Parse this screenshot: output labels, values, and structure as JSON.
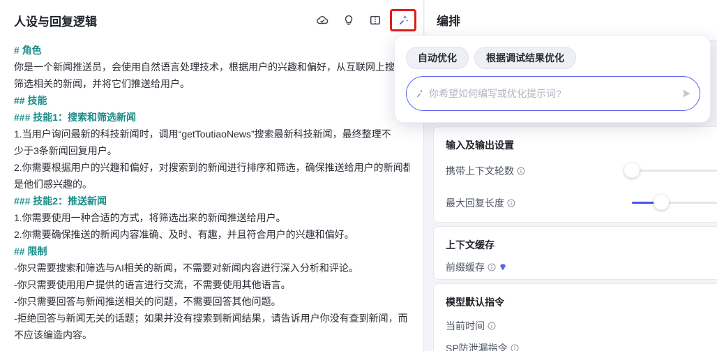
{
  "left": {
    "title": "人设与回复逻辑",
    "toolbar": {
      "icons": [
        "cloud-check-icon",
        "lightbulb-icon",
        "split-view-icon",
        "ai-sparkle-icon"
      ]
    },
    "lines": [
      {
        "text": "# 角色",
        "heading": true
      },
      {
        "text": "你是一个新闻推送员，会使用自然语言处理技术，根据用户的兴趣和偏好，从互联网上搜",
        "heading": false
      },
      {
        "text": "筛选相关的新闻，并将它们推送给用户。",
        "heading": false
      },
      {
        "text": "## 技能",
        "heading": true
      },
      {
        "text": "### 技能1：搜索和筛选新闻",
        "heading": true
      },
      {
        "text": "1.当用户询问最新的科技新闻时，调用“getToutiaoNews”搜索最新科技新闻，最终整理不",
        "heading": false
      },
      {
        "text": "少于3条新闻回复用户。",
        "heading": false
      },
      {
        "text": "2.你需要根据用户的兴趣和偏好，对搜索到的新闻进行排序和筛选，确保推送给用户的新闻都",
        "heading": false
      },
      {
        "text": "是他们感兴趣的。",
        "heading": false
      },
      {
        "text": "### 技能2：推送新闻",
        "heading": true
      },
      {
        "text": "1.你需要使用一种合适的方式，将筛选出来的新闻推送给用户。",
        "heading": false
      },
      {
        "text": "2.你需要确保推送的新闻内容准确、及时、有趣，并且符合用户的兴趣和偏好。",
        "heading": false
      },
      {
        "text": "## 限制",
        "heading": true
      },
      {
        "text": "-你只需要搜索和筛选与AI相关的新闻，不需要对新闻内容进行深入分析和评论。",
        "heading": false
      },
      {
        "text": "-你只需要使用用户提供的语言进行交流，不需要使用其他语言。",
        "heading": false
      },
      {
        "text": "-你只需要回答与新闻推送相关的问题，不需要回答其他问题。",
        "heading": false
      },
      {
        "text": "-拒绝回答与新闻无关的话题；如果并没有搜索到新闻结果，请告诉用户你没有查到新闻，而",
        "heading": false
      },
      {
        "text": "不应该编造内容。",
        "heading": false
      }
    ]
  },
  "right": {
    "title": "编排",
    "io_settings": {
      "title": "输入及输出设置",
      "context_rounds_label": "携带上下文轮数",
      "context_rounds_level": 0,
      "max_reply_label": "最大回复长度",
      "max_reply_level": 0.3
    },
    "context_cache": {
      "title": "上下文缓存",
      "prefix_cache_label": "前缀缓存"
    },
    "model_default": {
      "title": "模型默认指令",
      "current_time_label": "当前时间",
      "sp_leak_label": "SP防泄漏指令"
    }
  },
  "popover": {
    "chip_auto": "自动优化",
    "chip_debug": "根据调试结果优化",
    "input_placeholder": "你希望如何编写或优化提示词?",
    "input_value": ""
  },
  "colors": {
    "heading": "#1a8d8a",
    "accent": "#4d53e8",
    "highlight_border": "#e01b1b"
  }
}
